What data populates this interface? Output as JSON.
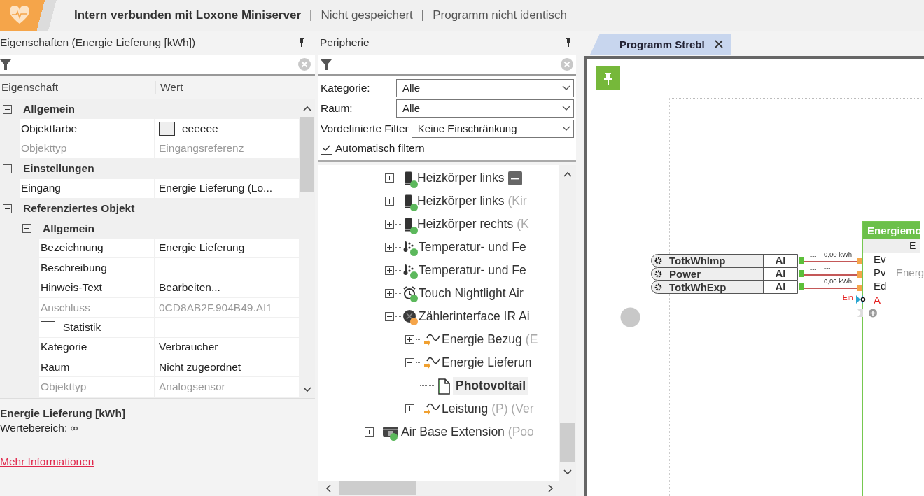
{
  "status_bar": {
    "items": [
      {
        "text": "Intern verbunden mit Loxone Miniserver",
        "bold": true
      },
      {
        "text": "Nicht gespeichert",
        "bold": false
      },
      {
        "text": "Programm nicht identisch",
        "bold": false
      }
    ],
    "separators": [
      "|",
      "|"
    ]
  },
  "properties_panel": {
    "title": "Eigenschaften (Energie Lieferung [kWh])",
    "columns": [
      "Eigenschaft",
      "Wert"
    ],
    "rows": [
      {
        "kind": "group",
        "label": "Allgemein",
        "expanded": true,
        "children": [
          {
            "kind": "color",
            "name": "Objektfarbe",
            "value": "eeeeee",
            "disabled": false
          },
          {
            "kind": "text",
            "name": "Objekttyp",
            "value": "Eingangsreferenz",
            "disabled": true
          }
        ]
      },
      {
        "kind": "group",
        "label": "Einstellungen",
        "expanded": true,
        "children": [
          {
            "kind": "text",
            "name": "Eingang",
            "value": "Energie Lieferung (Lo...",
            "disabled": false
          }
        ]
      },
      {
        "kind": "group",
        "label": "Referenziertes Objekt",
        "expanded": true,
        "children": [
          {
            "kind": "group",
            "label": "Allgemein",
            "expanded": true,
            "children": [
              {
                "kind": "text",
                "name": "Bezeichnung",
                "value": "Energie Lieferung",
                "disabled": false
              },
              {
                "kind": "text",
                "name": "Beschreibung",
                "disabled": false
              },
              {
                "kind": "text",
                "name": "Hinweis-Text",
                "value": "Bearbeiten...",
                "disabled": false
              },
              {
                "kind": "text",
                "name": "Anschluss",
                "value": "0CD8AB2F.904B49.AI1",
                "disabled": true
              },
              {
                "kind": "checkbox",
                "name": "Statistik",
                "checked": false,
                "disabled": false
              },
              {
                "kind": "text",
                "name": "Kategorie",
                "value": "Verbraucher",
                "disabled": false
              },
              {
                "kind": "text",
                "name": "Raum",
                "value": "Nicht zugeordnet",
                "disabled": false
              },
              {
                "kind": "text",
                "name": "Objekttyp",
                "value": "Analogsensor",
                "disabled": true
              }
            ]
          }
        ]
      }
    ],
    "description": {
      "title": "Energie Lieferung [kWh]",
      "text": "Wertebereich: ∞",
      "link": "Mehr Informationen"
    }
  },
  "peripherals_panel": {
    "title": "Peripherie",
    "filters": [
      {
        "label": "Kategorie:",
        "value": "Alle"
      },
      {
        "label": "Raum:",
        "value": "Alle"
      },
      {
        "label": "Vordefinierte Filter",
        "value": "Keine Einschränkung"
      }
    ],
    "auto_filter": {
      "label": "Automatisch filtern",
      "checked": true
    },
    "tree": [
      {
        "children": [
          {
            "label": "Heizkörper links",
            "kind": "radiator",
            "color": "#5cb85c",
            "expanded": false,
            "selected": false,
            "badge": true
          },
          {
            "label": "Heizkörper links",
            "suffix": "(Kir",
            "kind": "radiator",
            "color": "#5cb85c",
            "expanded": false,
            "selected": false,
            "badge": false
          },
          {
            "label": "Heizkörper rechts",
            "suffix": "(K",
            "kind": "radiator",
            "color": "#5cb85c",
            "expanded": false,
            "selected": false,
            "badge": false
          },
          {
            "label": "Temperatur- und Fe",
            "kind": "climate",
            "color": "#5cb85c",
            "expanded": false,
            "selected": false,
            "badge": false
          },
          {
            "label": "Temperatur- und Fe",
            "kind": "climate",
            "color": "#5cb85c",
            "expanded": false,
            "selected": false,
            "badge": false
          },
          {
            "label": "Touch Nightlight Air",
            "kind": "clock",
            "color": "#5cb85c",
            "expanded": false,
            "selected": false,
            "badge": false
          },
          {
            "label": "Zählerinterface IR Ai",
            "kind": "meter",
            "color": "#f5a54a",
            "expanded": true,
            "selected": false,
            "badge": false,
            "children": [
              {
                "label": "Energie Bezug",
                "suffix": "(E",
                "kind": "analog",
                "expanded": false,
                "selected": false,
                "badge": false
              },
              {
                "label": "Energie Lieferun",
                "kind": "analog",
                "expanded": true,
                "selected": false,
                "badge": false,
                "children": [
                  {
                    "label": "Photovoltail",
                    "kind": "document",
                    "selected": true,
                    "badge": false
                  }
                ]
              },
              {
                "label": "Leistung",
                "suffix": "(P) (Ver",
                "kind": "analog",
                "expanded": false,
                "selected": false,
                "badge": false
              }
            ]
          }
        ]
      },
      {
        "label": "Air Base Extension",
        "suffix": "(Poo",
        "kind": "extension",
        "color": "#5cb85c",
        "expanded": false,
        "selected": false,
        "badge": false
      }
    ]
  },
  "editor": {
    "tabs": [
      {
        "label": "Programm Strebl",
        "selected": true
      }
    ],
    "inputs": [
      {
        "name": "TotkWhImp",
        "type": "AI",
        "signal_left": "---",
        "signal": "0,00 kWh"
      },
      {
        "name": "Power",
        "type": "AI",
        "signal_left": "---",
        "signal": "---"
      },
      {
        "name": "TotkWhExp",
        "type": "AI",
        "signal_left": "---",
        "signal": "0,00 kWh"
      }
    ],
    "block": {
      "title": "Energiemo",
      "subtitle": "E",
      "description": "Energ",
      "input_hint": "Ein",
      "ports": [
        {
          "label": "Ev",
          "kind": "connected"
        },
        {
          "label": "Pv",
          "kind": "connected"
        },
        {
          "label": "Ed",
          "kind": "connected"
        },
        {
          "label": "A",
          "kind": "inverted"
        },
        {
          "kind": "add"
        }
      ]
    }
  }
}
